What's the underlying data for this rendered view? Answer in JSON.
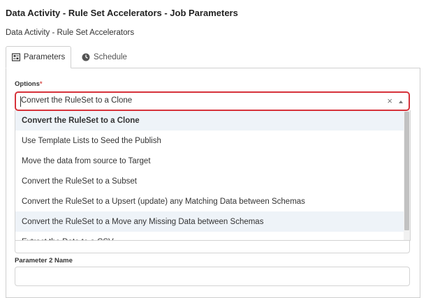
{
  "page": {
    "title": "Data Activity - Rule Set Accelerators - Job Parameters",
    "subtitle": "Data Activity - Rule Set Accelerators"
  },
  "tabs": [
    {
      "label": "Parameters",
      "icon": "parameters-icon",
      "active": true
    },
    {
      "label": "Schedule",
      "icon": "clock-icon",
      "active": false
    }
  ],
  "options": {
    "label": "Options",
    "required_mark": "*",
    "selected_value": "Convert the RuleSet to a Clone",
    "clear_glyph": "×",
    "items": [
      "Convert the RuleSet to a Clone",
      "Use Template Lists to Seed the Publish",
      "Move the data from source to Target",
      "Convert the RuleSet to a Subset",
      "Convert the RuleSet to a Upsert (update) any Matching Data between Schemas",
      "Convert the RuleSet to a Move any Missing Data between Schemas",
      "Extract the Data to a CSV"
    ]
  },
  "parameter2": {
    "label": "Parameter 2 Name",
    "value": ""
  },
  "colors": {
    "focus_border": "#d6323a",
    "highlight": "#eef3f8",
    "required": "#d9534f"
  }
}
